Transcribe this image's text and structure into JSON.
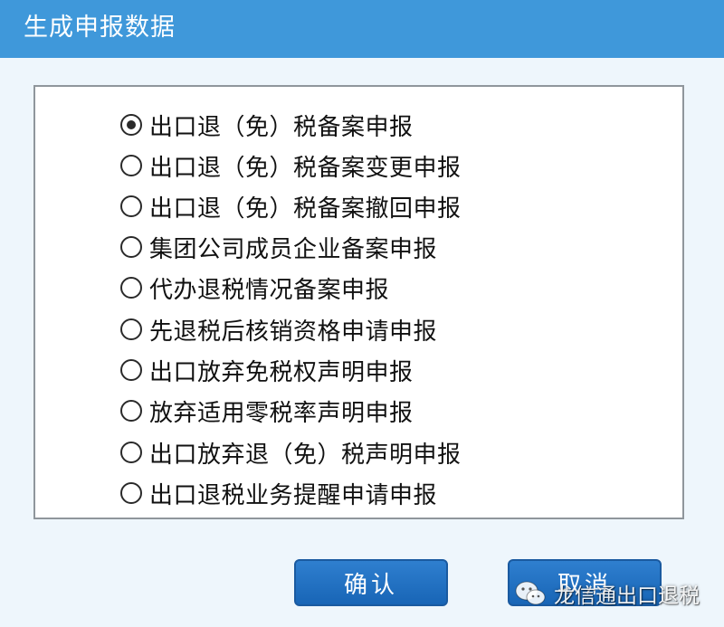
{
  "dialog": {
    "title": "生成申报数据"
  },
  "options": [
    {
      "label": "出口退（免）税备案申报",
      "checked": true
    },
    {
      "label": "出口退（免）税备案变更申报",
      "checked": false
    },
    {
      "label": "出口退（免）税备案撤回申报",
      "checked": false
    },
    {
      "label": "集团公司成员企业备案申报",
      "checked": false
    },
    {
      "label": "代办退税情况备案申报",
      "checked": false
    },
    {
      "label": "先退税后核销资格申请申报",
      "checked": false
    },
    {
      "label": "出口放弃免税权声明申报",
      "checked": false
    },
    {
      "label": "放弃适用零税率声明申报",
      "checked": false
    },
    {
      "label": "出口放弃退（免）税声明申报",
      "checked": false
    },
    {
      "label": "出口退税业务提醒申请申报",
      "checked": false
    }
  ],
  "buttons": {
    "ok_label": "确认",
    "cancel_label": "取消"
  },
  "watermark": {
    "icon": "wechat-icon",
    "text": "龙信通出口退税"
  },
  "colors": {
    "title_bar": "#3f98da",
    "background": "#eef6fc",
    "button": "#1865b6"
  }
}
